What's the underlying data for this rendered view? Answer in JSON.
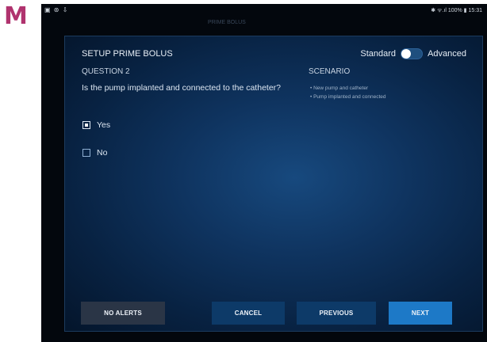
{
  "panel_label": "M",
  "status_bar": {
    "left_icons": "▣ ⊛ ⇩",
    "right_text": "✱ ᯤ.ıl 100% ▮ 15:31"
  },
  "background_hint": "PRIME BOLUS",
  "dialog": {
    "title": "SETUP PRIME BOLUS",
    "mode_toggle": {
      "left_label": "Standard",
      "right_label": "Advanced",
      "selected": "Standard"
    },
    "question_label": "QUESTION 2",
    "question_text": "Is the pump implanted and connected to the catheter?",
    "options": [
      {
        "label": "Yes",
        "checked": true
      },
      {
        "label": "No",
        "checked": false
      }
    ],
    "scenario_label": "SCENARIO",
    "scenario_items": [
      "New pump and catheter",
      "Pump implanted and connected"
    ],
    "buttons": {
      "no_alerts": "NO ALERTS",
      "cancel": "CANCEL",
      "previous": "PREVIOUS",
      "next": "NEXT"
    }
  },
  "colors": {
    "panel_label": "#b0336e",
    "next_button": "#1d79c7",
    "secondary_button": "#0d3a68",
    "no_alerts_button": "#2a3546"
  }
}
